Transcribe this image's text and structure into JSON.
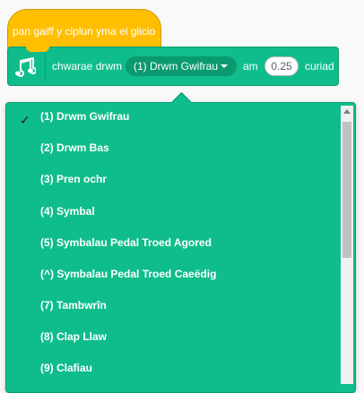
{
  "hat_block": {
    "text": "pan gaiff y ciplun yma ei glicio"
  },
  "drum_block": {
    "icon": "music-notes-icon",
    "label_play": "chwarae drwm",
    "selected_drum": "(1) Drwm Gwifrau",
    "label_for": "am",
    "beats_value": "0.25",
    "label_beats": "curiad"
  },
  "dropdown": {
    "checkmark": "✓",
    "items": [
      "(1) Drwm Gwifrau",
      "(2) Drwm Bas",
      "(3) Pren ochr",
      "(4) Symbal",
      "(5) Symbalau Pedal Troed Agored",
      "(^) Symbalau Pedal Troed Caeëdig",
      "(7) Tambwrîn",
      "(8) Clap Llaw",
      "(9) Clafiau"
    ]
  },
  "colors": {
    "hat_yellow": "#ffbf00",
    "music_green": "#0fbd8c",
    "music_green_dark": "#0b9a6f"
  }
}
